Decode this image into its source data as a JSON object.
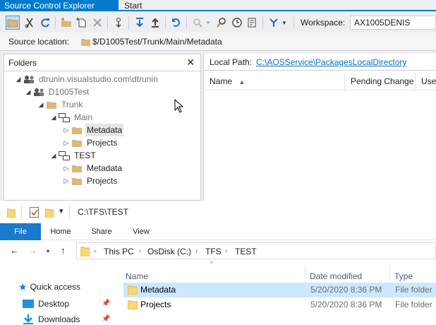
{
  "tabs": {
    "active": "Source Control Explorer",
    "inactive": "Start Page"
  },
  "toolbar": {
    "workspace_label": "Workspace:",
    "workspace_value": "AX1005DENIS"
  },
  "source_location": {
    "label": "Source location:",
    "path": "$/D1005Test/Trunk/Main/Metadata"
  },
  "folders_panel": {
    "title": "Folders",
    "close": "✕",
    "tree": [
      {
        "label": "dtrunin.visualstudio.com\\dtrunin",
        "icon": "team-server-icon",
        "arrow": "◢",
        "muted": true
      },
      {
        "label": "D1005Test",
        "icon": "team-project-icon",
        "arrow": "◢",
        "muted": true
      },
      {
        "label": "Trunk",
        "icon": "folder-icon",
        "arrow": "◢",
        "muted": true
      },
      {
        "label": "Main",
        "icon": "branch-icon",
        "arrow": "◢",
        "muted": true
      },
      {
        "label": "Metadata",
        "icon": "folder-icon",
        "arrow": "▷",
        "muted": false,
        "selected": true
      },
      {
        "label": "Projects",
        "icon": "folder-icon",
        "arrow": "▷",
        "muted": false
      },
      {
        "label": "TEST",
        "icon": "branch-icon",
        "arrow": "◢",
        "muted": false
      },
      {
        "label": "Metadata",
        "icon": "folder-icon",
        "arrow": "▷",
        "muted": false
      },
      {
        "label": "Projects",
        "icon": "folder-icon",
        "arrow": "▷",
        "muted": false
      }
    ]
  },
  "local_path": {
    "label": "Local Path:",
    "link": "C:\\AOSService\\PackagesLocalDirectory"
  },
  "list_columns": [
    "Name",
    "Pending Change",
    "User"
  ],
  "explorer": {
    "title_path": "C:\\TFS\\TEST",
    "ribbon_tabs": [
      "File",
      "Home",
      "Share",
      "View"
    ],
    "breadcrumbs": [
      "This PC",
      "OsDisk (C:)",
      "TFS",
      "TEST"
    ],
    "nav_items": [
      {
        "label": "Quick access",
        "icon": "star-icon"
      },
      {
        "label": "Desktop",
        "icon": "desktop-icon"
      },
      {
        "label": "Downloads",
        "icon": "download-icon"
      }
    ],
    "columns": [
      "Name",
      "Date modified",
      "Type"
    ],
    "files": [
      {
        "name": "Metadata",
        "date": "5/20/2020 8:36 PM",
        "type": "File folder",
        "selected": true
      },
      {
        "name": "Projects",
        "date": "5/20/2020 8:36 PM",
        "type": "File folder",
        "selected": false
      }
    ]
  },
  "colors": {
    "accent": "#007acc",
    "folder": "#dcb67a",
    "link": "#0e70c0",
    "selection": "#cce8ff"
  }
}
